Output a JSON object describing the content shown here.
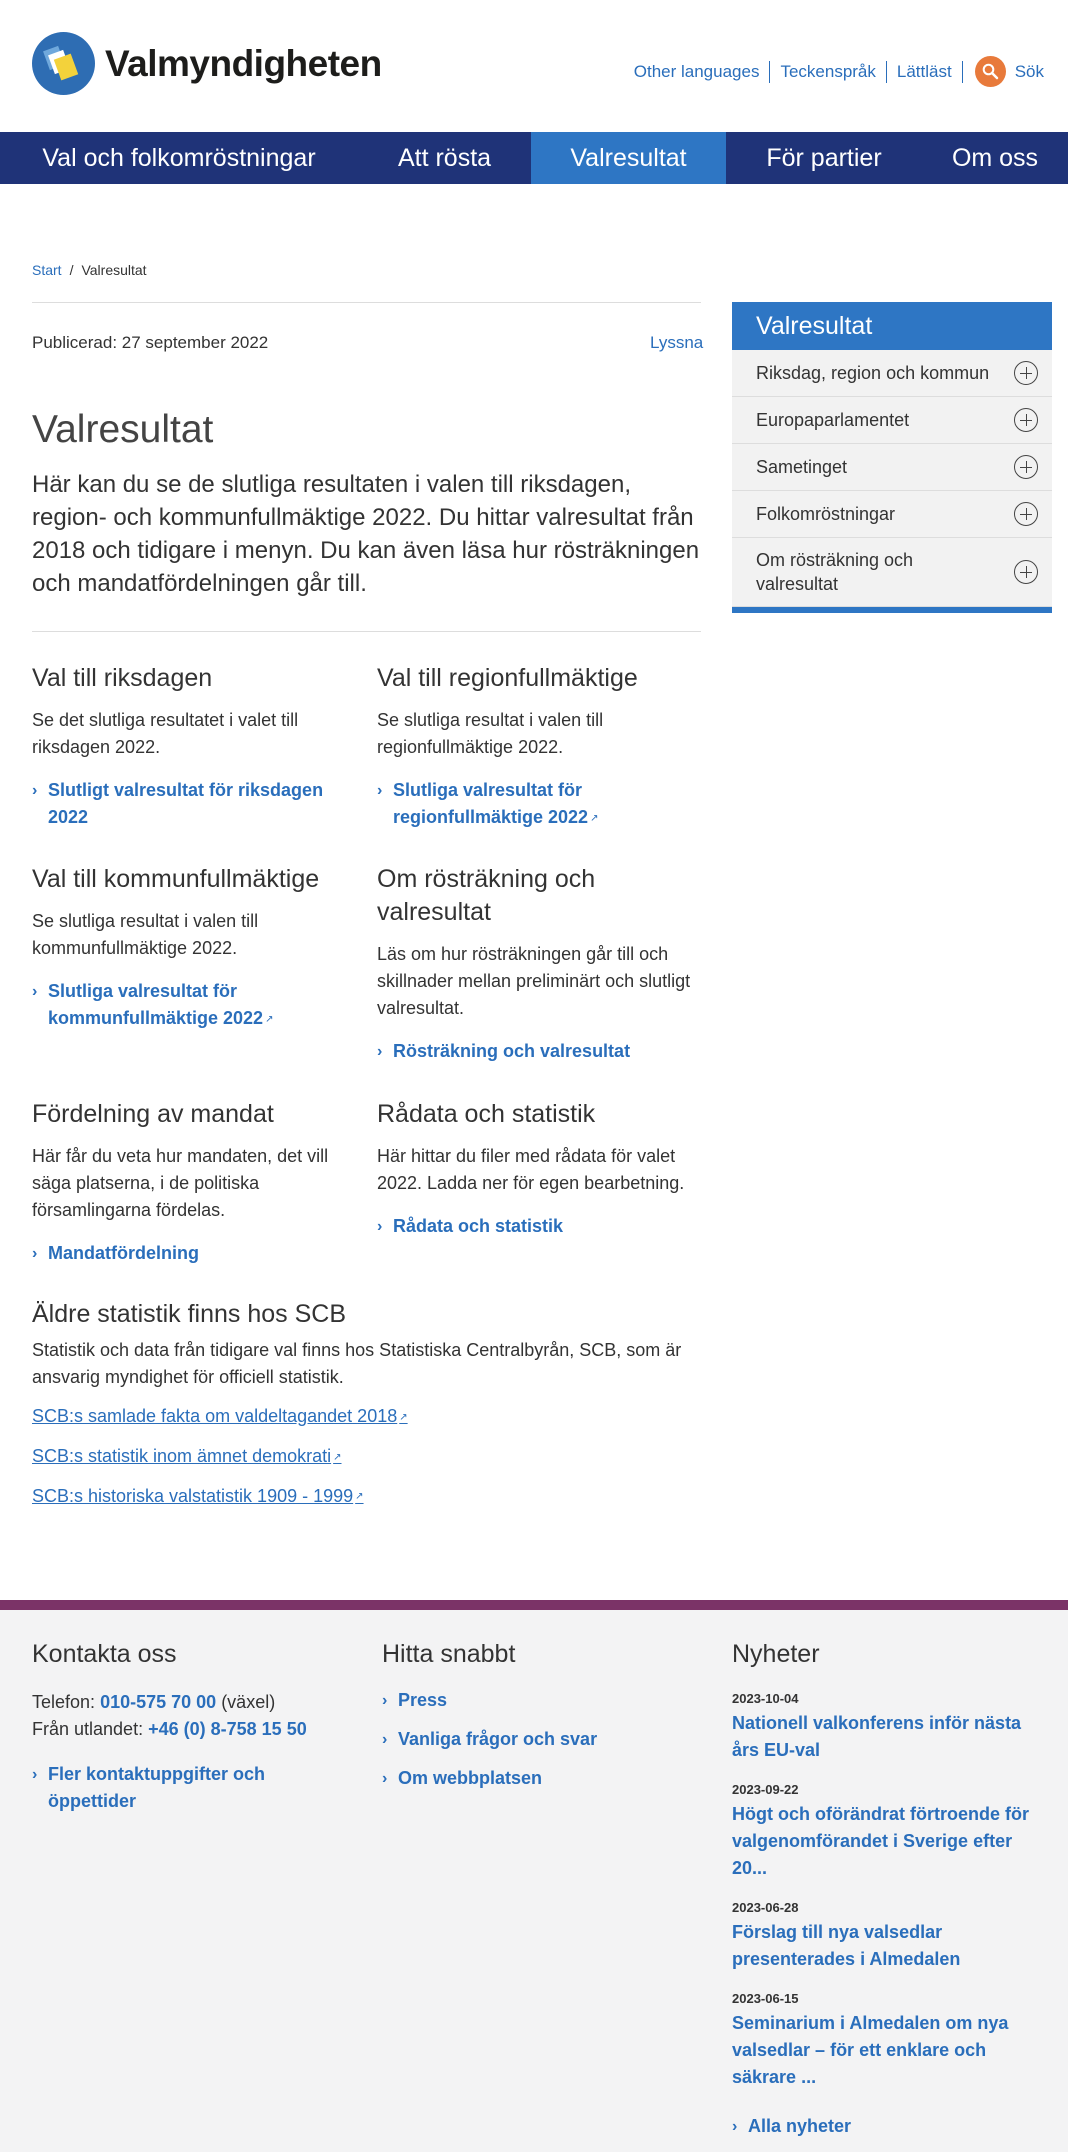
{
  "header": {
    "logo_text": "Valmyndigheten",
    "links": [
      "Other languages",
      "Teckenspråk",
      "Lättläst"
    ],
    "search_label": "Sök"
  },
  "nav": [
    "Val och folkomröstningar",
    "Att rösta",
    "Valresultat",
    "För partier",
    "Om oss"
  ],
  "breadcrumb": {
    "home": "Start",
    "current": "Valresultat"
  },
  "published": "Publicerad: 27 september 2022",
  "listen": "Lyssna",
  "title": "Valresultat",
  "lead": "Här kan du se de slutliga resultaten i valen till riksdagen, region- och kommunfullmäktige 2022. Du hittar valresultat från 2018 och tidigare i menyn. Du kan även läsa hur rösträkningen och mandatfördelningen går till.",
  "cards": [
    {
      "heading": "Val till riksdagen",
      "text": "Se det slutliga resultatet i valet till riksdagen 2022.",
      "link": "Slutligt valresultat för riksdagen 2022"
    },
    {
      "heading": "Val till regionfullmäktige",
      "text": "Se slutliga resultat i valen till regionfullmäktige 2022.",
      "link": "Slutliga valresultat för regionfullmäktige 2022"
    },
    {
      "heading": "Val till kommunfullmäktige",
      "text": "Se slutliga resultat i valen till kommunfullmäktige 2022.",
      "link": "Slutliga valresultat för kommunfullmäktige 2022"
    },
    {
      "heading": "Om rösträkning och valresultat",
      "text": "Läs om hur rösträkningen går till och skillnader mellan preliminärt och slutligt valresultat.",
      "link": "Rösträkning och valresultat"
    },
    {
      "heading": "Fördelning av mandat",
      "text": "Här får du veta hur mandaten, det vill säga platserna, i de politiska församlingarna fördelas.",
      "link": "Mandatfördelning"
    },
    {
      "heading": "Rådata och statistik",
      "text": "Här hittar du filer med rådata för valet 2022. Ladda ner för egen bearbetning.",
      "link": "Rådata och statistik"
    }
  ],
  "scb": {
    "heading": "Äldre statistik finns hos SCB",
    "text": "Statistik och data från tidigare val finns hos Statistiska Centralbyrån, SCB, som är ansvarig myndighet för officiell statistik.",
    "links": [
      "SCB:s samlade fakta om valdeltagandet 2018",
      "SCB:s statistik inom ämnet demokrati",
      "SCB:s historiska valstatistik 1909 - 1999"
    ]
  },
  "sidebar": {
    "title": "Valresultat",
    "items": [
      "Riksdag, region och kommun",
      "Europaparlamentet",
      "Sametinget",
      "Folkomröstningar",
      "Om rösträkning och valresultat"
    ]
  },
  "footer": {
    "contact": {
      "heading": "Kontakta oss",
      "phone_label": "Telefon:",
      "phone": "010-575 70 00",
      "phone_suffix": "(växel)",
      "abroad_label": "Från utlandet:",
      "abroad": "+46 (0) 8-758 15 50",
      "more": "Fler kontaktuppgifter och öppettider"
    },
    "quick": {
      "heading": "Hitta snabbt",
      "links": [
        "Press",
        "Vanliga frågor och svar",
        "Om webbplatsen"
      ]
    },
    "news": {
      "heading": "Nyheter",
      "items": [
        {
          "date": "2023-10-04",
          "title": "Nationell valkonferens inför nästa års EU-val"
        },
        {
          "date": "2023-09-22",
          "title": "Högt och oförändrat förtroende för valgenomförandet i Sverige efter 20..."
        },
        {
          "date": "2023-06-28",
          "title": "Förslag till nya valsedlar presenterades i Almedalen"
        },
        {
          "date": "2023-06-15",
          "title": "Seminarium i Almedalen om nya valsedlar – för ett enklare och säkrare ..."
        }
      ],
      "all": "Alla nyheter"
    }
  },
  "colors": {
    "nav_bg": "#1f3378",
    "accent_blue": "#2e76c4",
    "link": "#2a6ebb",
    "search_orange": "#e87a3b",
    "footer_border": "#7b3367"
  }
}
